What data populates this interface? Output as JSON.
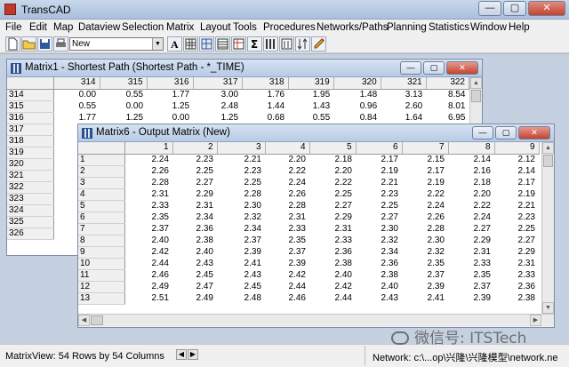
{
  "app": {
    "title": "TransCAD"
  },
  "menu": [
    "File",
    "Edit",
    "Map",
    "Dataview",
    "Selection",
    "Matrix",
    "Layout",
    "Tools",
    "Procedures",
    "Networks/Paths",
    "Planning",
    "Statistics",
    "Window",
    "Help"
  ],
  "toolbar": {
    "style_select_value": "New",
    "icons": [
      "new-file-icon",
      "open-folder-icon",
      "save-icon",
      "print-icon",
      "text-tool-icon",
      "matrix-icon",
      "grid-icon",
      "table-icon",
      "indices-icon",
      "sum-icon",
      "columns-icon",
      "list-icon",
      "sort-icon",
      "pencil-icon"
    ]
  },
  "matrix1": {
    "title": "Matrix1 - Shortest Path (Shortest Path - *_TIME)",
    "columns": [
      "314",
      "315",
      "316",
      "317",
      "318",
      "319",
      "320",
      "321",
      "322"
    ],
    "rows": [
      {
        "label": "314",
        "values": [
          "0.00",
          "0.55",
          "1.77",
          "3.00",
          "1.76",
          "1.95",
          "1.48",
          "3.13",
          "8.54"
        ]
      },
      {
        "label": "315",
        "values": [
          "0.55",
          "0.00",
          "1.25",
          "2.48",
          "1.44",
          "1.43",
          "0.96",
          "2.60",
          "8.01"
        ]
      },
      {
        "label": "316",
        "values": [
          "1.77",
          "1.25",
          "0.00",
          "1.25",
          "0.68",
          "0.55",
          "0.84",
          "1.64",
          "6.95"
        ]
      },
      {
        "label": "317",
        "values": []
      },
      {
        "label": "318",
        "values": []
      },
      {
        "label": "319",
        "values": []
      },
      {
        "label": "320",
        "values": []
      },
      {
        "label": "321",
        "values": []
      },
      {
        "label": "322",
        "values": []
      },
      {
        "label": "323",
        "values": []
      },
      {
        "label": "324",
        "values": []
      },
      {
        "label": "325",
        "values": []
      },
      {
        "label": "326",
        "values": []
      }
    ]
  },
  "matrix6": {
    "title": "Matrix6 - Output Matrix (New)",
    "columns": [
      "1",
      "2",
      "3",
      "4",
      "5",
      "6",
      "7",
      "8",
      "9"
    ],
    "rows": [
      {
        "label": "1",
        "values": [
          "2.24",
          "2.23",
          "2.21",
          "2.20",
          "2.18",
          "2.17",
          "2.15",
          "2.14",
          "2.12"
        ]
      },
      {
        "label": "2",
        "values": [
          "2.26",
          "2.25",
          "2.23",
          "2.22",
          "2.20",
          "2.19",
          "2.17",
          "2.16",
          "2.14"
        ]
      },
      {
        "label": "3",
        "values": [
          "2.28",
          "2.27",
          "2.25",
          "2.24",
          "2.22",
          "2.21",
          "2.19",
          "2.18",
          "2.17"
        ]
      },
      {
        "label": "4",
        "values": [
          "2.31",
          "2.29",
          "2.28",
          "2.26",
          "2.25",
          "2.23",
          "2.22",
          "2.20",
          "2.19"
        ]
      },
      {
        "label": "5",
        "values": [
          "2.33",
          "2.31",
          "2.30",
          "2.28",
          "2.27",
          "2.25",
          "2.24",
          "2.22",
          "2.21"
        ]
      },
      {
        "label": "6",
        "values": [
          "2.35",
          "2.34",
          "2.32",
          "2.31",
          "2.29",
          "2.27",
          "2.26",
          "2.24",
          "2.23"
        ]
      },
      {
        "label": "7",
        "values": [
          "2.37",
          "2.36",
          "2.34",
          "2.33",
          "2.31",
          "2.30",
          "2.28",
          "2.27",
          "2.25"
        ]
      },
      {
        "label": "8",
        "values": [
          "2.40",
          "2.38",
          "2.37",
          "2.35",
          "2.33",
          "2.32",
          "2.30",
          "2.29",
          "2.27"
        ]
      },
      {
        "label": "9",
        "values": [
          "2.42",
          "2.40",
          "2.39",
          "2.37",
          "2.36",
          "2.34",
          "2.32",
          "2.31",
          "2.29"
        ]
      },
      {
        "label": "10",
        "values": [
          "2.44",
          "2.43",
          "2.41",
          "2.39",
          "2.38",
          "2.36",
          "2.35",
          "2.33",
          "2.31"
        ]
      },
      {
        "label": "11",
        "values": [
          "2.46",
          "2.45",
          "2.43",
          "2.42",
          "2.40",
          "2.38",
          "2.37",
          "2.35",
          "2.33"
        ]
      },
      {
        "label": "12",
        "values": [
          "2.49",
          "2.47",
          "2.45",
          "2.44",
          "2.42",
          "2.40",
          "2.39",
          "2.37",
          "2.36"
        ]
      },
      {
        "label": "13",
        "values": [
          "2.51",
          "2.49",
          "2.48",
          "2.46",
          "2.44",
          "2.43",
          "2.41",
          "2.39",
          "2.38"
        ]
      }
    ]
  },
  "status": {
    "left": "MatrixView: 54 Rows by 54 Columns",
    "right": "Network: c:\\...op\\兴隆\\兴隆模型\\network.ne"
  },
  "watermark": "微信号: ITSTech"
}
